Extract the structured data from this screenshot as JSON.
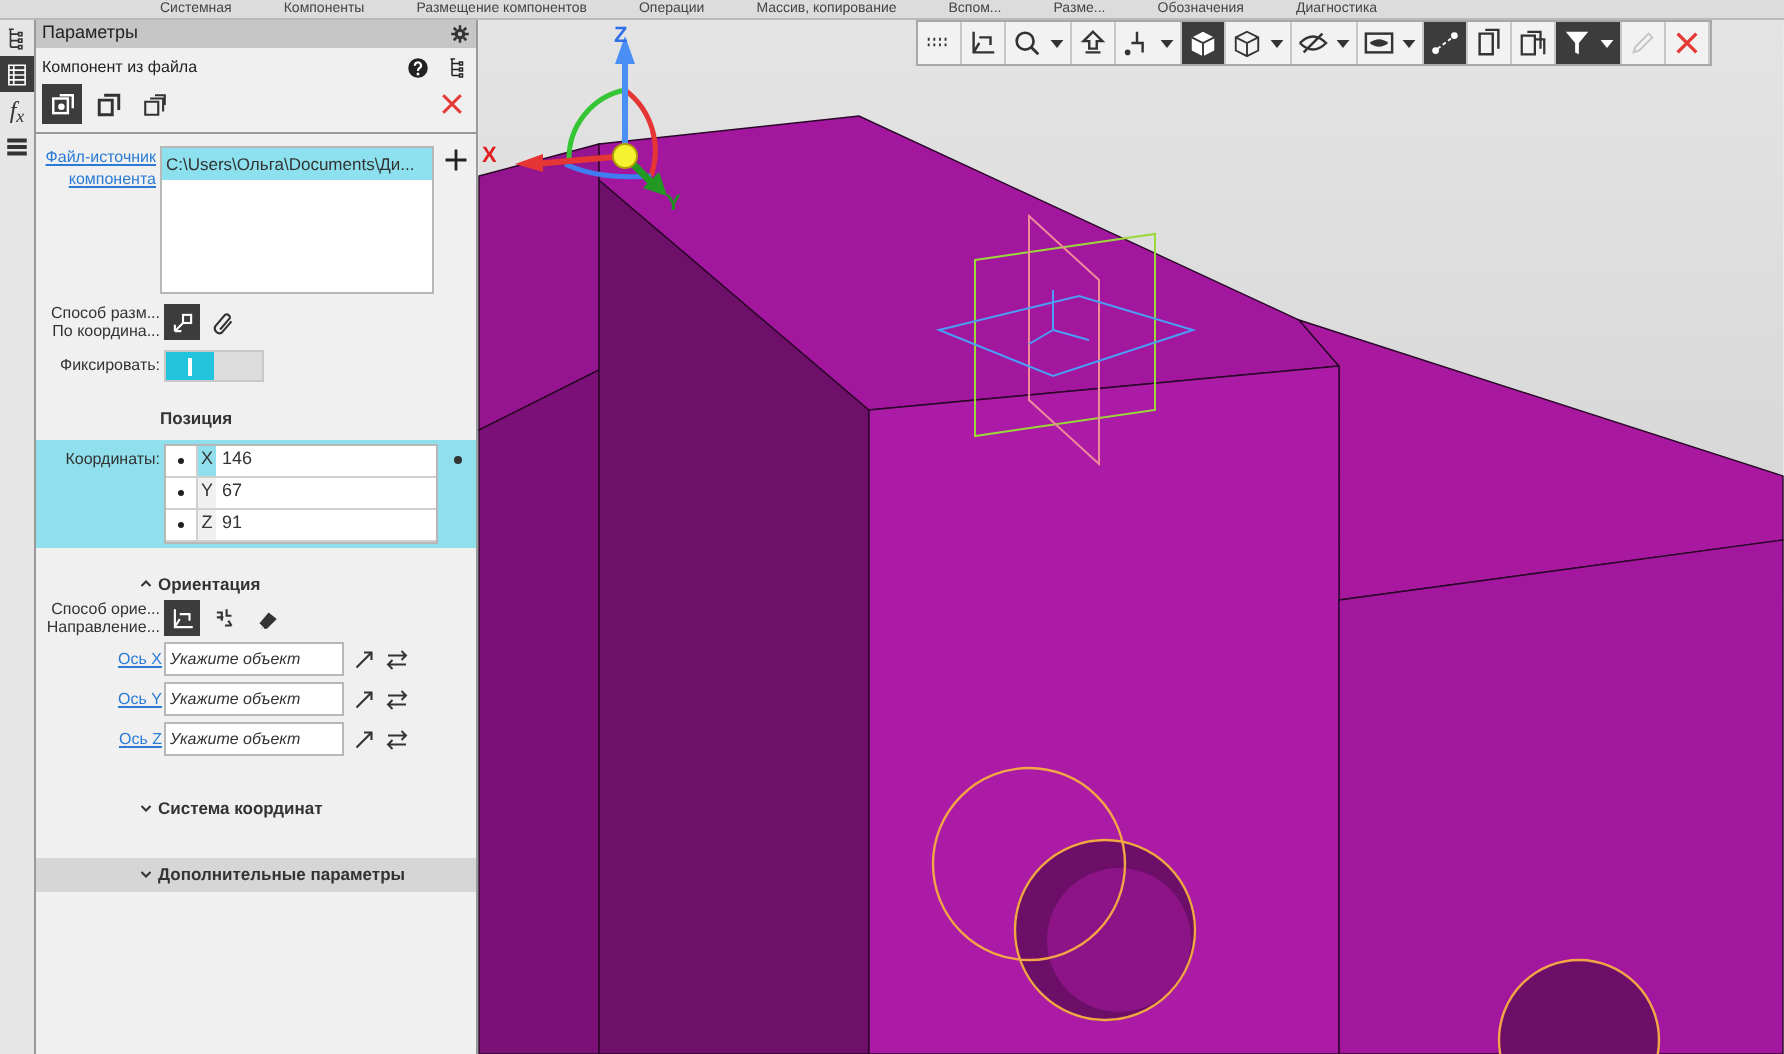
{
  "ribbon_tabs": [
    "Системная",
    "Компоненты",
    "Размещение компонентов",
    "Операции",
    "Массив, копирование",
    "Вспом...",
    "Разме...",
    "Обозначения",
    "Диагностика"
  ],
  "left_bar": [
    {
      "kind": "tree",
      "selected": false
    },
    {
      "kind": "table",
      "selected": true
    },
    {
      "kind": "fx",
      "text": "f$_{x}$",
      "selected": false
    },
    {
      "kind": "stack",
      "selected": false
    }
  ],
  "panel": {
    "title": "Параметры",
    "subtitle": "Компонент из файла",
    "modes": [
      {
        "kind": "component",
        "selected": true
      },
      {
        "kind": "sheet",
        "selected": false
      },
      {
        "kind": "layers",
        "selected": false
      }
    ],
    "source_label": "Файл-источник компонента",
    "source_files": [
      {
        "text": "C:\\Users\\Ольга\\Documents\\Ди...",
        "selected": true
      }
    ],
    "placement_labels": [
      "Способ разм...",
      "По координа..."
    ],
    "placement_modes": [
      {
        "kind": "coords",
        "selected": true
      },
      {
        "kind": "clip",
        "selected": false
      }
    ],
    "fix": {
      "label": "Фиксировать:",
      "on": true
    },
    "position": {
      "title": "Позиция",
      "label": "Координаты:",
      "coords": [
        {
          "axis": "X",
          "value": "146",
          "selected": true
        },
        {
          "axis": "Y",
          "value": "67",
          "selected": false
        },
        {
          "axis": "Z",
          "value": "91",
          "selected": false
        }
      ]
    },
    "orientation": {
      "title": "Ориентация",
      "expanded": true,
      "labels": [
        "Способ орие...",
        "Направление..."
      ],
      "modes": [
        {
          "kind": "axes",
          "selected": true
        },
        {
          "kind": "vectors",
          "selected": false
        },
        {
          "kind": "eraser",
          "selected": false
        }
      ],
      "axes": [
        {
          "label": "Ось X",
          "placeholder": "Укажите объект"
        },
        {
          "label": "Ось Y",
          "placeholder": "Укажите объект"
        },
        {
          "label": "Ось Z",
          "placeholder": "Укажите объект"
        }
      ]
    },
    "sections": [
      {
        "title": "Система координат",
        "expanded": false,
        "kind": "plain"
      },
      {
        "title": "Дополнительные параметры",
        "expanded": false,
        "kind": "band"
      }
    ]
  },
  "toolbar": [
    {
      "kind": "grip",
      "selected": false,
      "dropdown": false
    },
    {
      "kind": "axes",
      "selected": false,
      "dropdown": false
    },
    {
      "kind": "zoom",
      "selected": false,
      "dropdown": true
    },
    {
      "kind": "pan",
      "selected": false,
      "dropdown": false
    },
    {
      "kind": "point",
      "selected": false,
      "dropdown": true
    },
    {
      "kind": "cube",
      "selected": true,
      "dropdown": false
    },
    {
      "kind": "wirecube",
      "selected": false,
      "dropdown": true
    },
    {
      "kind": "hide",
      "selected": false,
      "dropdown": true
    },
    {
      "kind": "show",
      "selected": false,
      "dropdown": true
    },
    {
      "kind": "connect",
      "selected": true,
      "dropdown": false
    },
    {
      "kind": "docs",
      "selected": false,
      "dropdown": false
    },
    {
      "kind": "docs2",
      "selected": false,
      "dropdown": false
    },
    {
      "kind": "filter",
      "selected": true,
      "dropdown": true
    },
    {
      "kind": "pencil",
      "selected": false,
      "dropdown": false,
      "disabled": true
    },
    {
      "kind": "close",
      "selected": false,
      "dropdown": false
    }
  ],
  "triad": {
    "x": "X",
    "y": "Y",
    "z": "Z"
  }
}
